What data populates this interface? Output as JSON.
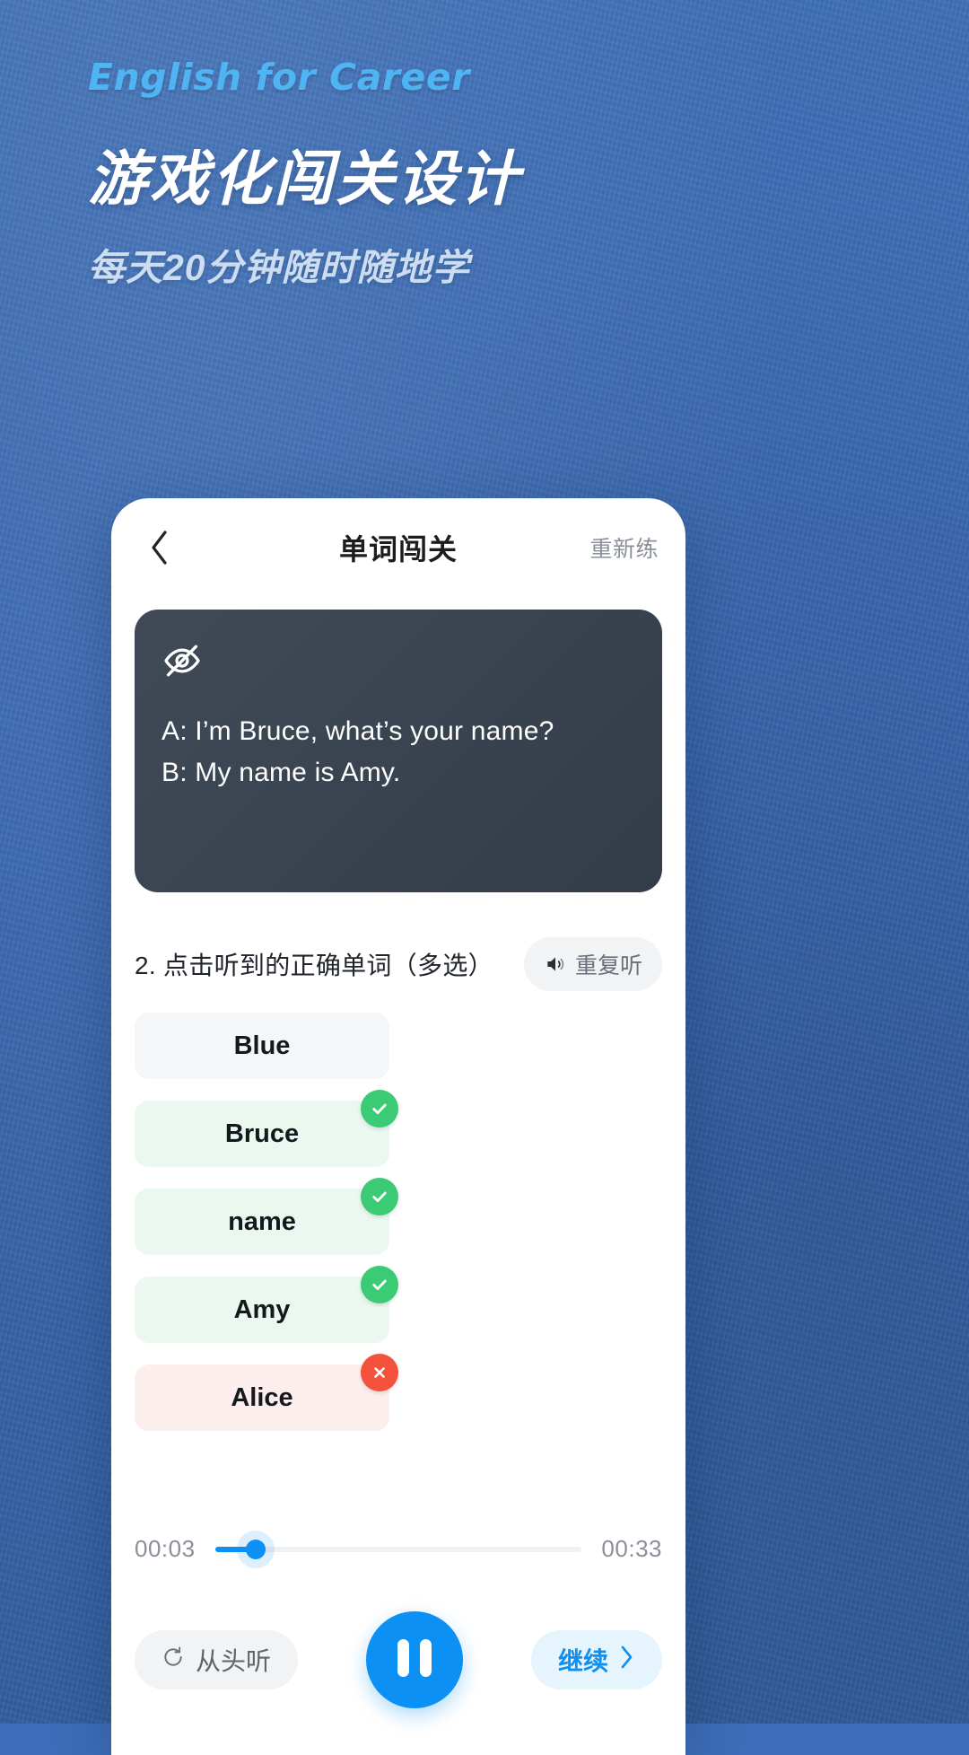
{
  "hero": {
    "eyebrow": "English for Career",
    "title": "游戏化闯关设计",
    "subtitle": "每天20分钟随时随地学"
  },
  "colors": {
    "background_blue": "#3d6db8",
    "eyebrow_blue": "#4fb4f3",
    "accent_blue": "#0d90f3",
    "correct_green": "#3ccb75",
    "wrong_red": "#f4523c",
    "dialogue_dark": "#3a434f"
  },
  "appbar": {
    "back_icon": "chevron-left-icon",
    "title": "单词闯关",
    "action_label": "重新练"
  },
  "dialogue": {
    "visibility_icon": "eye-off-icon",
    "lines": [
      "A: I’m Bruce, what’s your name?",
      "B: My name is Amy."
    ]
  },
  "question": {
    "prompt": "2. 点击听到的正确单词（多选）",
    "repeat_button": {
      "icon": "speaker-icon",
      "label": "重复听"
    },
    "options": [
      {
        "label": "Blue",
        "state": "neutral",
        "badge": "none"
      },
      {
        "label": "Bruce",
        "state": "correct",
        "badge": "check"
      },
      {
        "label": "name",
        "state": "correct",
        "badge": "check"
      },
      {
        "label": "Amy",
        "state": "correct",
        "badge": "check"
      },
      {
        "label": "Alice",
        "state": "wrong",
        "badge": "cross"
      }
    ]
  },
  "player": {
    "current_time": "00:03",
    "total_time": "00:33",
    "progress_percent": 11,
    "restart_button": {
      "icon": "restart-icon",
      "label": "从头听"
    },
    "play_button": {
      "icon": "pause-icon",
      "state": "playing"
    },
    "next_button": {
      "label": "继续",
      "icon": "chevron-right-icon"
    }
  }
}
